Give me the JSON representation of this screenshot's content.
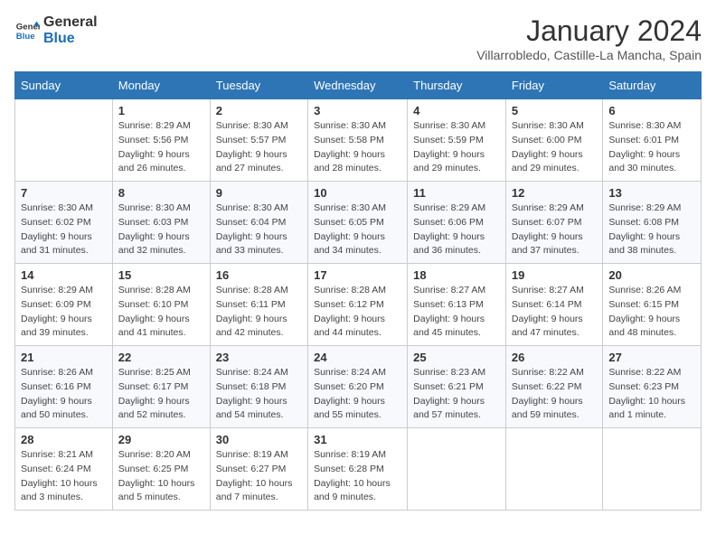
{
  "header": {
    "logo_line1": "General",
    "logo_line2": "Blue",
    "month": "January 2024",
    "location": "Villarrobledo, Castille-La Mancha, Spain"
  },
  "days_of_week": [
    "Sunday",
    "Monday",
    "Tuesday",
    "Wednesday",
    "Thursday",
    "Friday",
    "Saturday"
  ],
  "weeks": [
    [
      {
        "num": "",
        "detail": ""
      },
      {
        "num": "1",
        "detail": "Sunrise: 8:29 AM\nSunset: 5:56 PM\nDaylight: 9 hours\nand 26 minutes."
      },
      {
        "num": "2",
        "detail": "Sunrise: 8:30 AM\nSunset: 5:57 PM\nDaylight: 9 hours\nand 27 minutes."
      },
      {
        "num": "3",
        "detail": "Sunrise: 8:30 AM\nSunset: 5:58 PM\nDaylight: 9 hours\nand 28 minutes."
      },
      {
        "num": "4",
        "detail": "Sunrise: 8:30 AM\nSunset: 5:59 PM\nDaylight: 9 hours\nand 29 minutes."
      },
      {
        "num": "5",
        "detail": "Sunrise: 8:30 AM\nSunset: 6:00 PM\nDaylight: 9 hours\nand 29 minutes."
      },
      {
        "num": "6",
        "detail": "Sunrise: 8:30 AM\nSunset: 6:01 PM\nDaylight: 9 hours\nand 30 minutes."
      }
    ],
    [
      {
        "num": "7",
        "detail": "Sunrise: 8:30 AM\nSunset: 6:02 PM\nDaylight: 9 hours\nand 31 minutes."
      },
      {
        "num": "8",
        "detail": "Sunrise: 8:30 AM\nSunset: 6:03 PM\nDaylight: 9 hours\nand 32 minutes."
      },
      {
        "num": "9",
        "detail": "Sunrise: 8:30 AM\nSunset: 6:04 PM\nDaylight: 9 hours\nand 33 minutes."
      },
      {
        "num": "10",
        "detail": "Sunrise: 8:30 AM\nSunset: 6:05 PM\nDaylight: 9 hours\nand 34 minutes."
      },
      {
        "num": "11",
        "detail": "Sunrise: 8:29 AM\nSunset: 6:06 PM\nDaylight: 9 hours\nand 36 minutes."
      },
      {
        "num": "12",
        "detail": "Sunrise: 8:29 AM\nSunset: 6:07 PM\nDaylight: 9 hours\nand 37 minutes."
      },
      {
        "num": "13",
        "detail": "Sunrise: 8:29 AM\nSunset: 6:08 PM\nDaylight: 9 hours\nand 38 minutes."
      }
    ],
    [
      {
        "num": "14",
        "detail": "Sunrise: 8:29 AM\nSunset: 6:09 PM\nDaylight: 9 hours\nand 39 minutes."
      },
      {
        "num": "15",
        "detail": "Sunrise: 8:28 AM\nSunset: 6:10 PM\nDaylight: 9 hours\nand 41 minutes."
      },
      {
        "num": "16",
        "detail": "Sunrise: 8:28 AM\nSunset: 6:11 PM\nDaylight: 9 hours\nand 42 minutes."
      },
      {
        "num": "17",
        "detail": "Sunrise: 8:28 AM\nSunset: 6:12 PM\nDaylight: 9 hours\nand 44 minutes."
      },
      {
        "num": "18",
        "detail": "Sunrise: 8:27 AM\nSunset: 6:13 PM\nDaylight: 9 hours\nand 45 minutes."
      },
      {
        "num": "19",
        "detail": "Sunrise: 8:27 AM\nSunset: 6:14 PM\nDaylight: 9 hours\nand 47 minutes."
      },
      {
        "num": "20",
        "detail": "Sunrise: 8:26 AM\nSunset: 6:15 PM\nDaylight: 9 hours\nand 48 minutes."
      }
    ],
    [
      {
        "num": "21",
        "detail": "Sunrise: 8:26 AM\nSunset: 6:16 PM\nDaylight: 9 hours\nand 50 minutes."
      },
      {
        "num": "22",
        "detail": "Sunrise: 8:25 AM\nSunset: 6:17 PM\nDaylight: 9 hours\nand 52 minutes."
      },
      {
        "num": "23",
        "detail": "Sunrise: 8:24 AM\nSunset: 6:18 PM\nDaylight: 9 hours\nand 54 minutes."
      },
      {
        "num": "24",
        "detail": "Sunrise: 8:24 AM\nSunset: 6:20 PM\nDaylight: 9 hours\nand 55 minutes."
      },
      {
        "num": "25",
        "detail": "Sunrise: 8:23 AM\nSunset: 6:21 PM\nDaylight: 9 hours\nand 57 minutes."
      },
      {
        "num": "26",
        "detail": "Sunrise: 8:22 AM\nSunset: 6:22 PM\nDaylight: 9 hours\nand 59 minutes."
      },
      {
        "num": "27",
        "detail": "Sunrise: 8:22 AM\nSunset: 6:23 PM\nDaylight: 10 hours\nand 1 minute."
      }
    ],
    [
      {
        "num": "28",
        "detail": "Sunrise: 8:21 AM\nSunset: 6:24 PM\nDaylight: 10 hours\nand 3 minutes."
      },
      {
        "num": "29",
        "detail": "Sunrise: 8:20 AM\nSunset: 6:25 PM\nDaylight: 10 hours\nand 5 minutes."
      },
      {
        "num": "30",
        "detail": "Sunrise: 8:19 AM\nSunset: 6:27 PM\nDaylight: 10 hours\nand 7 minutes."
      },
      {
        "num": "31",
        "detail": "Sunrise: 8:19 AM\nSunset: 6:28 PM\nDaylight: 10 hours\nand 9 minutes."
      },
      {
        "num": "",
        "detail": ""
      },
      {
        "num": "",
        "detail": ""
      },
      {
        "num": "",
        "detail": ""
      }
    ]
  ]
}
